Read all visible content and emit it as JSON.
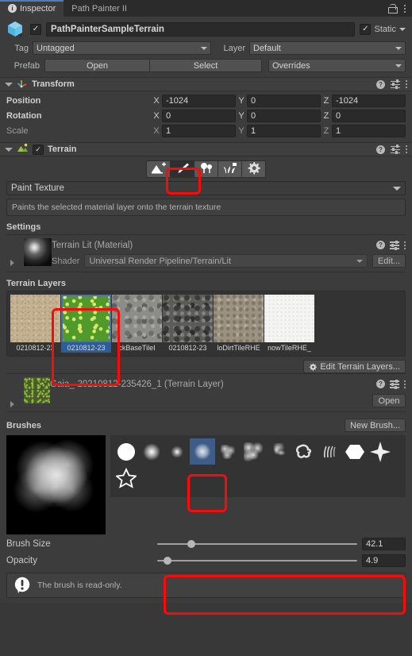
{
  "window": {
    "tabs": [
      {
        "label": "Inspector",
        "icon": "info-icon",
        "active": true
      },
      {
        "label": "Path Painter II",
        "icon": "",
        "active": false
      }
    ],
    "lock_icon": "lock-icon",
    "menu_icon": "kebab-menu-icon"
  },
  "object_header": {
    "icon": "game-object-cube-icon",
    "enabled": true,
    "name": "PathPainterSampleTerrain",
    "static_label": "Static",
    "static_checked": true,
    "tag_label": "Tag",
    "tag_value": "Untagged",
    "layer_label": "Layer",
    "layer_value": "Default",
    "prefab_label": "Prefab",
    "prefab_open": "Open",
    "prefab_select": "Select",
    "prefab_overrides": "Overrides"
  },
  "transform": {
    "title": "Transform",
    "icon": "transform-axis-icon",
    "help_icon": "help-icon",
    "preset_icon": "preset-icon",
    "menu_icon": "kebab-menu-icon",
    "rows": [
      {
        "label": "Position",
        "dim": false,
        "x": "-1024",
        "y": "0",
        "z": "-1024"
      },
      {
        "label": "Rotation",
        "dim": false,
        "x": "0",
        "y": "0",
        "z": "0"
      },
      {
        "label": "Scale",
        "dim": true,
        "x": "1",
        "y": "1",
        "z": "1"
      }
    ],
    "axes": [
      "X",
      "Y",
      "Z"
    ]
  },
  "terrain": {
    "title": "Terrain",
    "icon": "terrain-icon",
    "enabled": true,
    "help_icon": "help-icon",
    "preset_icon": "preset-icon",
    "menu_icon": "kebab-menu-icon",
    "toolbar": [
      {
        "name": "create-neighbor-terrains-tool",
        "icon": "terrain-plus-icon",
        "selected": false
      },
      {
        "name": "paint-terrain-tool",
        "icon": "paintbrush-icon",
        "selected": true
      },
      {
        "name": "paint-trees-tool",
        "icon": "tree-icon",
        "selected": false
      },
      {
        "name": "paint-details-tool",
        "icon": "grass-details-icon",
        "selected": false
      },
      {
        "name": "terrain-settings-tool",
        "icon": "gear-icon",
        "selected": false
      }
    ],
    "mode_dropdown": "Paint Texture",
    "help_text": "Paints the selected material layer onto the terrain texture",
    "settings_title": "Settings",
    "material": {
      "name": "Terrain Lit (Material)",
      "preview_icon": "material-sphere-preview",
      "shader_label": "Shader",
      "shader_value": "Universal Render Pipeline/Terrain/Lit",
      "edit_button": "Edit...",
      "help_icon": "help-icon",
      "preset_icon": "preset-icon",
      "menu_icon": "kebab-menu-icon"
    },
    "layers_title": "Terrain Layers",
    "layers": [
      {
        "label": "0210812-23",
        "selected": false,
        "swatch": "sand"
      },
      {
        "label": "0210812-23",
        "selected": true,
        "swatch": "grass"
      },
      {
        "label": "ckBaseTileI",
        "selected": false,
        "swatch": "rock"
      },
      {
        "label": "0210812-23",
        "selected": false,
        "swatch": "darkrock"
      },
      {
        "label": "loDirtTileRHE",
        "selected": false,
        "swatch": "dirt"
      },
      {
        "label": "nowTileRHE_",
        "selected": false,
        "swatch": "snow"
      }
    ],
    "edit_layers_button": "Edit Terrain Layers...",
    "layer_detail": {
      "name": "Gaia_-20210812-235426_1 (Terrain Layer)",
      "open_button": "Open",
      "help_icon": "help-icon",
      "preset_icon": "preset-icon",
      "menu_icon": "kebab-menu-icon"
    },
    "brushes_title": "Brushes",
    "new_brush_button": "New Brush...",
    "brush_preview_icon": "brush-preview-cloud",
    "brush_items": [
      {
        "name": "brush-solid-circle",
        "selected": false
      },
      {
        "name": "brush-soft-falloff",
        "selected": false
      },
      {
        "name": "brush-small-soft",
        "selected": false
      },
      {
        "name": "brush-noise-cluster",
        "selected": true
      },
      {
        "name": "brush-splatter-small",
        "selected": false
      },
      {
        "name": "brush-splatter-medium",
        "selected": false
      },
      {
        "name": "brush-splatter-wispy",
        "selected": false
      },
      {
        "name": "brush-organic-blob",
        "selected": false
      },
      {
        "name": "brush-streaks",
        "selected": false
      },
      {
        "name": "brush-hexagon",
        "selected": false
      },
      {
        "name": "brush-six-point-star",
        "selected": false
      },
      {
        "name": "brush-star-outline",
        "selected": false
      }
    ],
    "brush_size_label": "Brush Size",
    "brush_size_value": "42.1",
    "brush_size_pct": 17,
    "opacity_label": "Opacity",
    "opacity_value": "4.9",
    "opacity_pct": 5,
    "warning_icon": "warning-speech-icon",
    "warning_text": "The brush is read-only."
  },
  "colors": {
    "accent_blue": "#4b73a8",
    "selection_blue": "#2c5d99",
    "annotation_red": "#fb0a0a",
    "panel_bg": "#3c3c3c",
    "window_bg": "#383838"
  }
}
